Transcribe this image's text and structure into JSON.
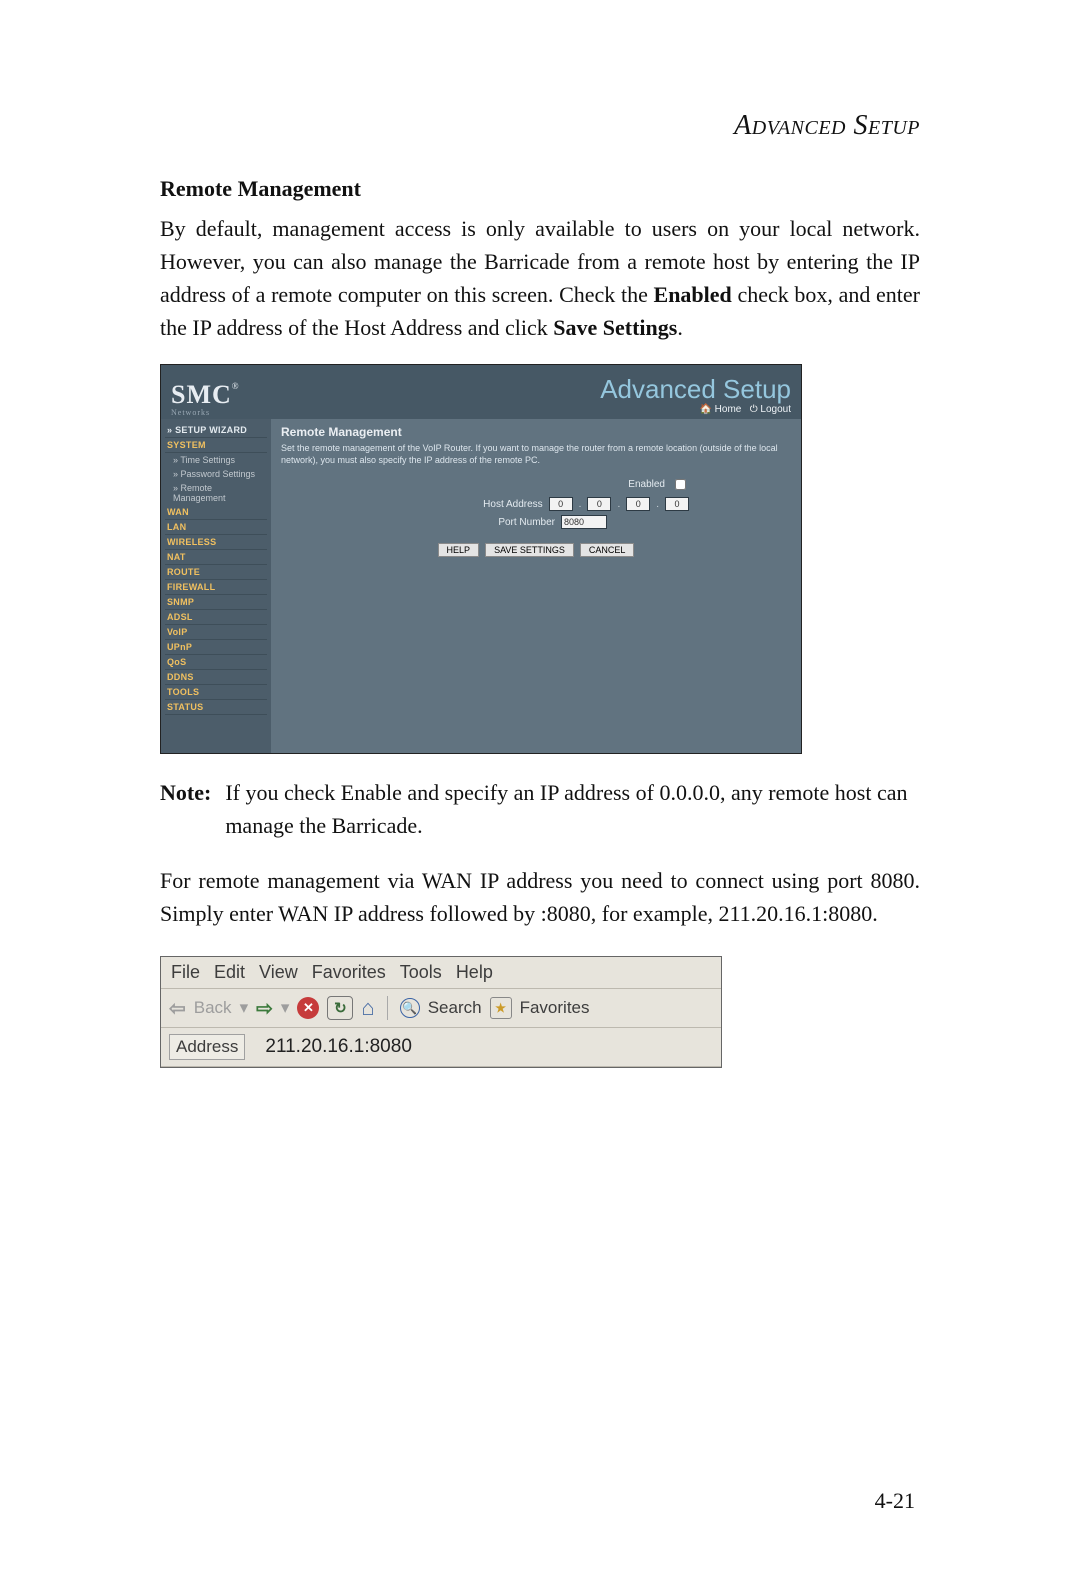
{
  "doc": {
    "section_title": "Advanced Setup",
    "subtitle": "Remote Management",
    "intro_1": "By default, management access is only available to users on your local network. However, you can also manage the Barricade from a remote host by entering the IP address of a remote computer on this screen. Check the ",
    "intro_bold1": "Enabled",
    "intro_2": " check box, and enter the IP address of the Host Address and click ",
    "intro_bold2": "Save Settings",
    "intro_3": ".",
    "note_label": "Note:",
    "note_body": "If you check Enable and specify an IP address of 0.0.0.0, any remote host can manage the Barricade.",
    "para1": "For remote management via WAN IP address you need to connect using port 8080. Simply enter WAN IP address followed by :8080, for example, 211.20.16.1:8080.",
    "page_number": "4-21"
  },
  "router": {
    "brand": "SMC",
    "brand_reg": "®",
    "brand_sub": "Networks",
    "banner": "Advanced Setup",
    "home": "Home",
    "logout": "Logout",
    "content_title": "Remote Management",
    "content_desc": "Set the remote management of the VoIP Router. If you want to manage the router from a remote location (outside of the local network), you must also specify the IP address of the remote PC.",
    "enabled_label": "Enabled",
    "host_label": "Host Address",
    "port_label": "Port Number",
    "host_oct": [
      "0",
      "0",
      "0",
      "0"
    ],
    "port_value": "8080",
    "btn_help": "HELP",
    "btn_save": "SAVE SETTINGS",
    "btn_cancel": "CANCEL",
    "nav": {
      "setup_wizard": "» SETUP WIZARD",
      "system": "SYSTEM",
      "sys_children": [
        "» Time Settings",
        "» Password Settings",
        "» Remote Management"
      ],
      "items": [
        "WAN",
        "LAN",
        "WIRELESS",
        "NAT",
        "ROUTE",
        "FIREWALL",
        "SNMP",
        "ADSL",
        "VoIP",
        "UPnP",
        "QoS",
        "DDNS",
        "TOOLS",
        "STATUS"
      ]
    }
  },
  "ie": {
    "menu": [
      "File",
      "Edit",
      "View",
      "Favorites",
      "Tools",
      "Help"
    ],
    "back": "Back",
    "search": "Search",
    "favorites": "Favorites",
    "address_label": "Address",
    "address_value": "211.20.16.1:8080"
  }
}
